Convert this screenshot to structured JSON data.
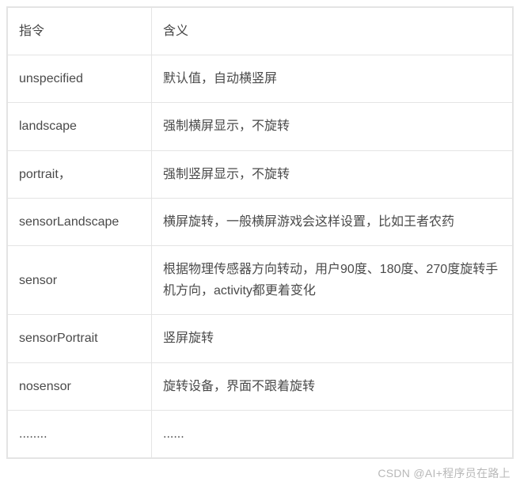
{
  "table": {
    "header": {
      "col1": "指令",
      "col2": "含义"
    },
    "rows": [
      {
        "c1": "unspecified",
        "c2": "默认值，自动横竖屏"
      },
      {
        "c1": "landscape",
        "c2": "强制横屏显示，不旋转"
      },
      {
        "c1": "portrait，",
        "c2": "强制竖屏显示，不旋转"
      },
      {
        "c1": "sensorLandscape",
        "c2": "横屏旋转，一般横屏游戏会这样设置，比如王者农药"
      },
      {
        "c1": "sensor",
        "c2": "根据物理传感器方向转动，用户90度、180度、270度旋转手机方向，activity都更着变化"
      },
      {
        "c1": "sensorPortrait",
        "c2": "竖屏旋转"
      },
      {
        "c1": "nosensor",
        "c2": "旋转设备，界面不跟着旋转"
      },
      {
        "c1": "........",
        "c2": "......"
      }
    ]
  },
  "watermark": "CSDN @AI+程序员在路上"
}
